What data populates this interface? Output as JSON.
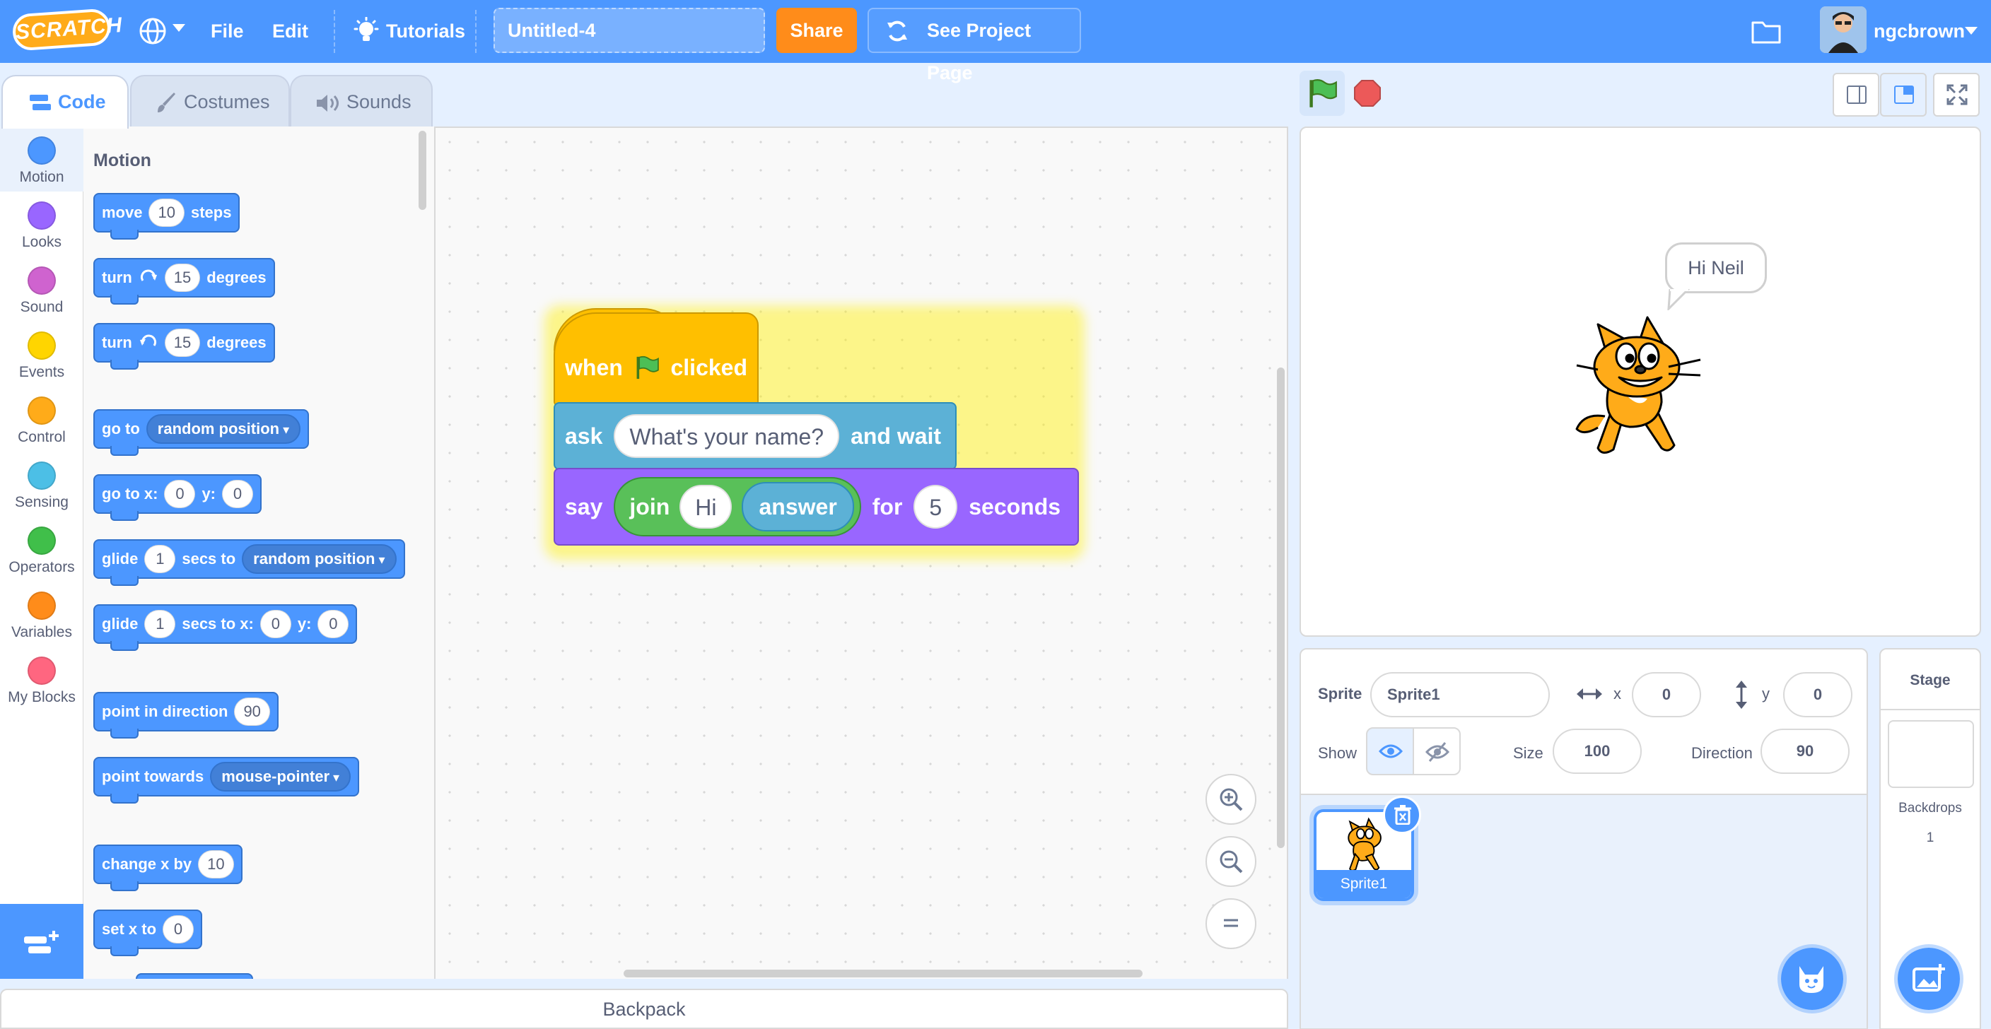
{
  "menu": {
    "logo": "SCRATCH",
    "file": "File",
    "edit": "Edit",
    "tutorials": "Tutorials",
    "project_title": "Untitled-4",
    "share": "Share",
    "see_project_page": "See Project Page",
    "username": "ngcbrown"
  },
  "tabs": {
    "code": "Code",
    "costumes": "Costumes",
    "sounds": "Sounds"
  },
  "categories": [
    {
      "label": "Motion",
      "color": "#4c97ff"
    },
    {
      "label": "Looks",
      "color": "#9966ff"
    },
    {
      "label": "Sound",
      "color": "#cf63cf"
    },
    {
      "label": "Events",
      "color": "#ffd500"
    },
    {
      "label": "Control",
      "color": "#ffab19"
    },
    {
      "label": "Sensing",
      "color": "#4cbfe6"
    },
    {
      "label": "Operators",
      "color": "#40bf4a"
    },
    {
      "label": "Variables",
      "color": "#ff8c1a"
    },
    {
      "label": "My Blocks",
      "color": "#ff6680"
    }
  ],
  "palette": {
    "heading": "Motion",
    "move": {
      "a": "move",
      "v": "10",
      "b": "steps"
    },
    "turn_right": {
      "a": "turn",
      "v": "15",
      "b": "degrees"
    },
    "turn_left": {
      "a": "turn",
      "v": "15",
      "b": "degrees"
    },
    "goto": {
      "a": "go to",
      "d": "random position"
    },
    "goto_xy": {
      "a": "go to x:",
      "x": "0",
      "b": "y:",
      "y": "0"
    },
    "glide_to": {
      "a": "glide",
      "v": "1",
      "b": "secs to",
      "d": "random position"
    },
    "glide_xy": {
      "a": "glide",
      "v": "1",
      "b": "secs to x:",
      "x": "0",
      "c": "y:",
      "y": "0"
    },
    "point_dir": {
      "a": "point in direction",
      "v": "90"
    },
    "point_towards": {
      "a": "point towards",
      "d": "mouse-pointer"
    },
    "change_x": {
      "a": "change x by",
      "v": "10"
    },
    "set_x": {
      "a": "set x to",
      "v": "0"
    }
  },
  "script": {
    "hat_when": "when",
    "hat_clicked": "clicked",
    "ask": "ask",
    "ask_text": "What's your name?",
    "and_wait": "and wait",
    "say": "say",
    "join": "join",
    "join_a": "Hi",
    "answer": "answer",
    "for": "for",
    "secs": "5",
    "seconds": "seconds"
  },
  "stage": {
    "speech": "Hi Neil"
  },
  "sprite_info": {
    "sprite_label": "Sprite",
    "sprite_name": "Sprite1",
    "x_label": "x",
    "x": "0",
    "y_label": "y",
    "y": "0",
    "show_label": "Show",
    "size_label": "Size",
    "size": "100",
    "direction_label": "Direction",
    "direction": "90"
  },
  "sprites": [
    {
      "name": "Sprite1"
    }
  ],
  "stage_pane": {
    "title": "Stage",
    "backdrops_label": "Backdrops",
    "backdrops_count": "1"
  },
  "backpack": "Backpack"
}
